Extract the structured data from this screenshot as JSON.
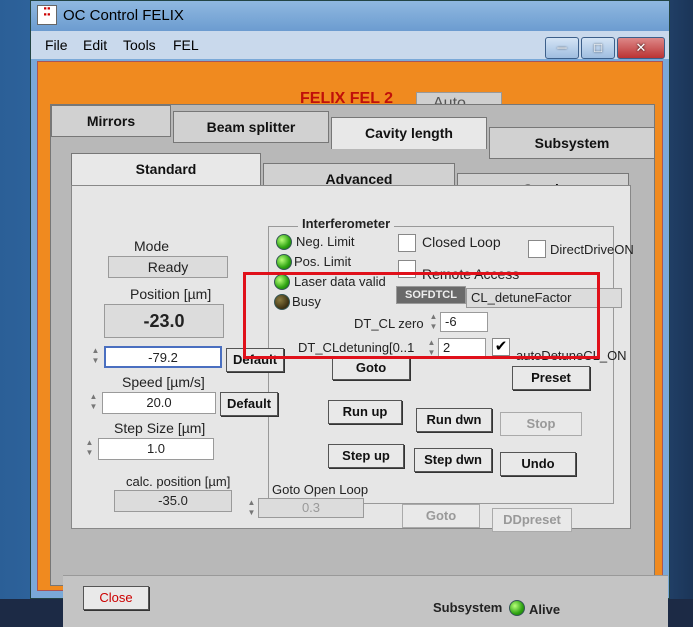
{
  "window": {
    "title": "OC Control FELIX"
  },
  "menu": [
    "File",
    "Edit",
    "Tools",
    "FEL"
  ],
  "header": {
    "fel_name": "FELIX FEL 2",
    "mode_select": "Auto"
  },
  "tabs": [
    "Mirrors",
    "Beam splitter",
    "Cavity length",
    "Subsystem"
  ],
  "subtabs": [
    "Standard",
    "Advanced",
    "Graph"
  ],
  "left": {
    "mode_label": "Mode",
    "mode_value": "Ready",
    "position_label": "Position [µm]",
    "position_value": "-23.0",
    "target_value": "-79.2",
    "default1": "Default",
    "speed_label": "Speed [µm/s]",
    "speed_value": "20.0",
    "default2": "Default",
    "step_label": "Step Size [µm]",
    "step_value": "1.0",
    "calc_label": "calc. position [µm]",
    "calc_value": "-35.0"
  },
  "interferometer": {
    "title": "Interferometer",
    "neg_limit": "Neg. Limit",
    "pos_limit": "Pos. Limit",
    "laser_valid": "Laser data valid",
    "busy": "Busy",
    "closed_loop": "Closed Loop",
    "direct_drive": "DirectDriveON",
    "remote_access": "Remote Access",
    "dropdown_left": "SOFDTCL",
    "dropdown_right": "CL_detuneFactor",
    "dt_zero_label": "DT_CL zero",
    "dt_zero_value": "-6",
    "dt_detuning_label": "DT_CLdetuning[0..1",
    "dt_detuning_value": "2",
    "auto_detune": "autoDetuneCL_ON"
  },
  "buttons": {
    "goto": "Goto",
    "preset": "Preset",
    "run_up": "Run up",
    "run_dwn": "Run dwn",
    "stop": "Stop",
    "step_up": "Step up",
    "step_dwn": "Step dwn",
    "undo": "Undo",
    "goto2": "Goto",
    "ddpreset": "DDpreset",
    "close": "Close"
  },
  "open_loop": {
    "label": "Goto Open Loop",
    "value": "0.3"
  },
  "status": {
    "label": "Subsystem",
    "value": "Alive"
  }
}
